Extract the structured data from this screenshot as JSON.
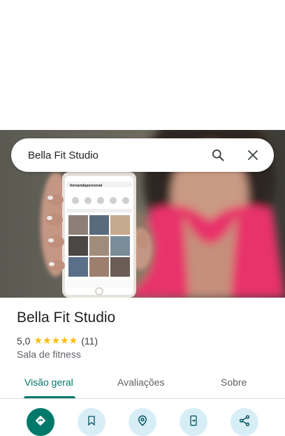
{
  "search": {
    "query": "Bella Fit Studio"
  },
  "phone_screen": {
    "username": "fernandapersonal"
  },
  "place": {
    "title": "Bella Fit Studio",
    "rating": "5,0",
    "stars": "★★★★★",
    "review_count": "(11)",
    "category": "Sala de fitness"
  },
  "tabs": [
    {
      "label": "Visão geral",
      "active": true
    },
    {
      "label": "Avaliações",
      "active": false
    },
    {
      "label": "Sobre",
      "active": false
    }
  ],
  "actions": [
    {
      "icon": "directions-icon"
    },
    {
      "icon": "bookmark-icon"
    },
    {
      "icon": "nearby-icon"
    },
    {
      "icon": "send-to-phone-icon"
    },
    {
      "icon": "share-icon"
    }
  ],
  "colors": {
    "accent": "#00796b",
    "star": "#fbbc04",
    "action_bg": "#d7eef7",
    "jacket": "#e8336b"
  }
}
